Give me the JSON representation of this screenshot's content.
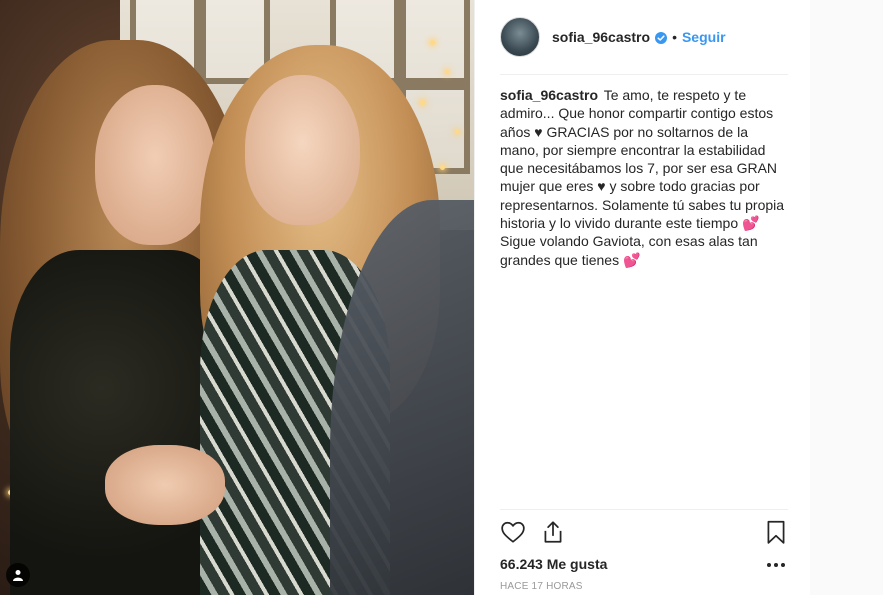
{
  "post": {
    "username": "sofia_96castro",
    "follow_label": "Seguir",
    "separator": "•",
    "caption_user": "sofia_96castro",
    "caption_text": "Te amo, te respeto y te admiro... Que honor compartir contigo estos años ♥ GRACIAS por no soltarnos de la mano, por siempre encontrar la estabilidad que necesitábamos los 7, por ser esa GRAN mujer que eres ♥ y sobre todo gracias por representarnos. Solamente tú sabes tu propia historia y lo vivido durante este tiempo 💕 Sigue volando Gaviota, con esas alas tan grandes que tienes 💕",
    "likes": "66.243 Me gusta",
    "timestamp": "HACE 17 HORAS"
  },
  "icons": {
    "verified": "verified-badge-icon",
    "like": "heart-icon",
    "share": "share-icon",
    "save": "bookmark-icon",
    "more": "more-options-icon",
    "user_tag": "user-tag-icon"
  },
  "colors": {
    "link": "#3897f0",
    "text": "#262626",
    "muted": "#999999",
    "divider": "#efefef"
  }
}
